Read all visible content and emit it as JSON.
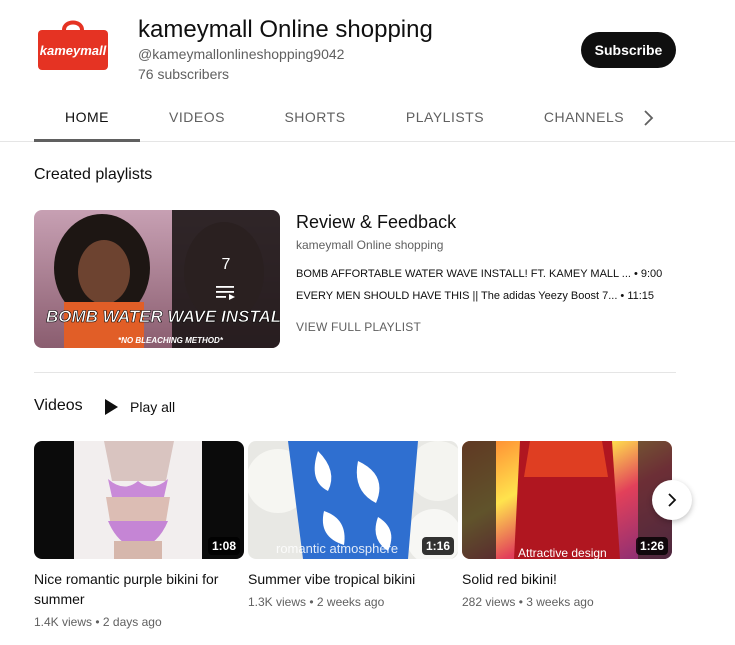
{
  "channel": {
    "logo_text": "kameymall",
    "name": "kameymall Online shopping",
    "handle": "@kameymallonlineshopping9042",
    "subscribers": "76 subscribers",
    "subscribe_label": "Subscribe",
    "logo_color": "#e53323"
  },
  "tabs": [
    {
      "label": "HOME",
      "active": true
    },
    {
      "label": "VIDEOS",
      "active": false
    },
    {
      "label": "SHORTS",
      "active": false
    },
    {
      "label": "PLAYLISTS",
      "active": false
    },
    {
      "label": "CHANNELS",
      "active": false
    }
  ],
  "created_playlists": {
    "heading": "Created playlists",
    "playlist": {
      "count": "7",
      "thumb_caption": "BOMB WATER WAVE INSTALL",
      "thumb_subcaption": "*NO BLEACHING METHOD*",
      "title": "Review & Feedback",
      "owner": "kameymall Online shopping",
      "items": [
        {
          "title": "BOMB AFFORTABLE WATER WAVE INSTALL! FT. KAMEY MALL ...",
          "duration": "• 9:00"
        },
        {
          "title": "EVERY MEN SHOULD HAVE THIS || The adidas Yeezy Boost 7...",
          "duration": "• 11:15"
        }
      ],
      "view_full_label": "VIEW FULL PLAYLIST"
    }
  },
  "videos_section": {
    "heading": "Videos",
    "play_all_label": "Play all",
    "videos": [
      {
        "title": "Nice romantic purple bikini for summer",
        "duration": "1:08",
        "views": "1.4K views",
        "age": "2 days ago",
        "overlay": ""
      },
      {
        "title": "Summer vibe tropical bikini",
        "duration": "1:16",
        "views": "1.3K views",
        "age": "2 weeks ago",
        "overlay": "romantic atmosphere"
      },
      {
        "title": "Solid red bikini!",
        "duration": "1:26",
        "views": "282 views",
        "age": "3 weeks ago",
        "overlay": "Attractive design"
      }
    ]
  },
  "icons": {
    "logo": "shopping-bag-icon",
    "tabs_next": "chevron-right-icon",
    "queue": "playlist-queue-icon",
    "play": "play-icon",
    "carousel_next": "chevron-right-icon"
  }
}
